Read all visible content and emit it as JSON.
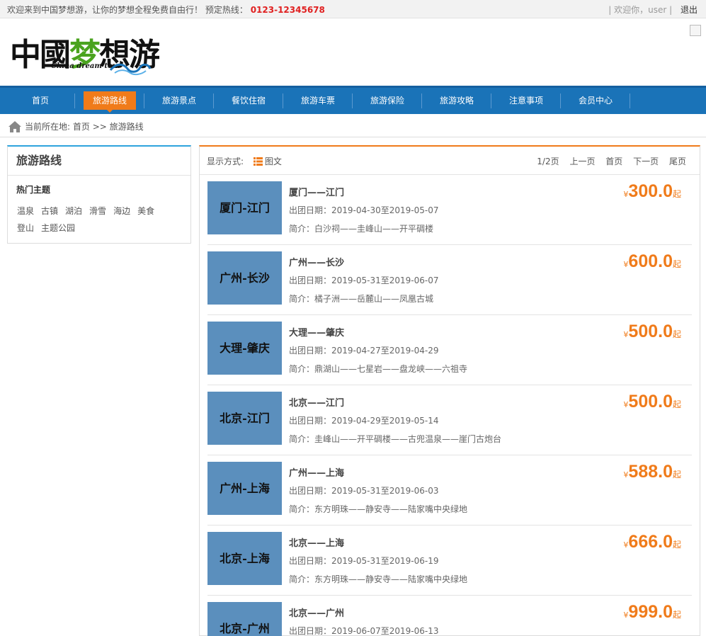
{
  "topbar": {
    "welcome": "欢迎来到中国梦想游，让你的梦想全程免费自由行！",
    "hotline_label": "预定热线：",
    "hotline": "0123-12345678",
    "user_greeting": "| 欢迎你，user |",
    "logout": "退出"
  },
  "logo": {
    "main_black": "中國",
    "main_green": "梦",
    "main_black2": "想游",
    "sub": "China dream tour"
  },
  "nav": [
    {
      "label": "首页",
      "active": false
    },
    {
      "label": "旅游路线",
      "active": true
    },
    {
      "label": "旅游景点",
      "active": false
    },
    {
      "label": "餐饮住宿",
      "active": false
    },
    {
      "label": "旅游车票",
      "active": false
    },
    {
      "label": "旅游保险",
      "active": false
    },
    {
      "label": "旅游攻略",
      "active": false
    },
    {
      "label": "注意事项",
      "active": false
    },
    {
      "label": "会员中心",
      "active": false
    }
  ],
  "breadcrumb": {
    "prefix": "当前所在地:",
    "home": "首页",
    "sep": ">>",
    "current": "旅游路线"
  },
  "sidebar": {
    "title": "旅游路线",
    "subtitle": "热门主题",
    "tags": [
      "温泉",
      "古镇",
      "湖泊",
      "滑雪",
      "海边",
      "美食",
      "登山",
      "主题公园"
    ]
  },
  "toolbar": {
    "display_label": "显示方式:",
    "mode": "图文",
    "page_info": "1/2页",
    "prev": "上一页",
    "first": "首页",
    "next": "下一页",
    "last": "尾页"
  },
  "routes": [
    {
      "thumb": "厦门-江门",
      "name": "厦门——江门",
      "date": "出团日期：2019-04-30至2019-05-07",
      "intro": "简介：白沙祠——圭峰山——开平碉楼",
      "price": "300.0"
    },
    {
      "thumb": "广州-长沙",
      "name": "广州——长沙",
      "date": "出团日期：2019-05-31至2019-06-07",
      "intro": "简介：橘子洲——岳麓山——凤凰古城",
      "price": "600.0"
    },
    {
      "thumb": "大理-肇庆",
      "name": "大理——肇庆",
      "date": "出团日期：2019-04-27至2019-04-29",
      "intro": "简介：鼎湖山——七星岩——盘龙峡——六祖寺",
      "price": "500.0"
    },
    {
      "thumb": "北京-江门",
      "name": "北京——江门",
      "date": "出团日期：2019-04-29至2019-05-14",
      "intro": "简介：圭峰山——开平碉楼——古兜温泉——崖门古炮台",
      "price": "500.0"
    },
    {
      "thumb": "广州-上海",
      "name": "广州——上海",
      "date": "出团日期：2019-05-31至2019-06-03",
      "intro": "简介：东方明珠——静安寺——陆家嘴中央绿地",
      "price": "588.0"
    },
    {
      "thumb": "北京-上海",
      "name": "北京——上海",
      "date": "出团日期：2019-05-31至2019-06-19",
      "intro": "简介：东方明珠——静安寺——陆家嘴中央绿地",
      "price": "666.0"
    },
    {
      "thumb": "北京-广州",
      "name": "北京——广州",
      "date": "出团日期：2019-06-07至2019-06-13",
      "intro": "",
      "price": "999.0"
    }
  ],
  "price_currency": "¥",
  "price_unit": "起",
  "colors": {
    "nav_blue": "#1a73b8",
    "accent_orange": "#f07b1a",
    "sidebar_blue": "#2ea3dd",
    "thumb_blue": "#5b8fbd",
    "hotline_red": "#e02020"
  }
}
